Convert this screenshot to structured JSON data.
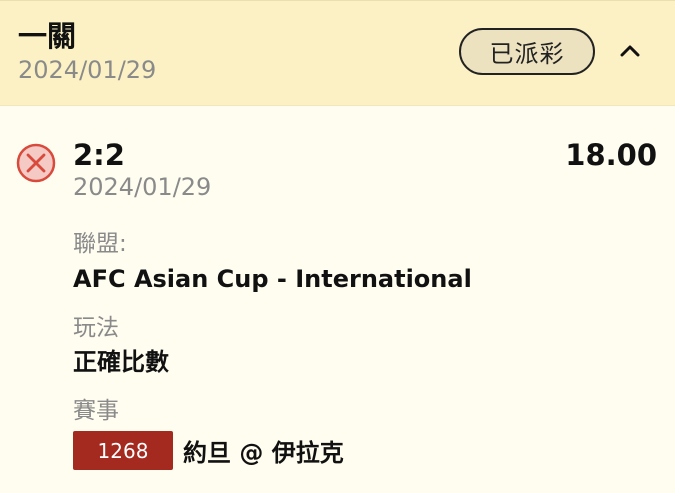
{
  "header": {
    "bet_type": "一關",
    "date": "2024/01/29",
    "status": "已派彩",
    "toggle_icon": "chevron-up-icon"
  },
  "selection": {
    "result_icon": "x-circle-icon",
    "score": "2:2",
    "odds": "18.00",
    "date": "2024/01/29"
  },
  "details": {
    "league_label": "聯盟:",
    "league_value": "AFC Asian Cup - International",
    "bet_type_label": "玩法",
    "bet_type_value": "正確比數",
    "event_label": "賽事",
    "event_code": "1268",
    "event_name": "約旦 @ 伊拉克"
  },
  "colors": {
    "header_bg": "#fbf1c4",
    "body_bg": "#fffdf0",
    "code_badge_bg": "#a42a1f",
    "lost_icon": "#d84a3c"
  }
}
